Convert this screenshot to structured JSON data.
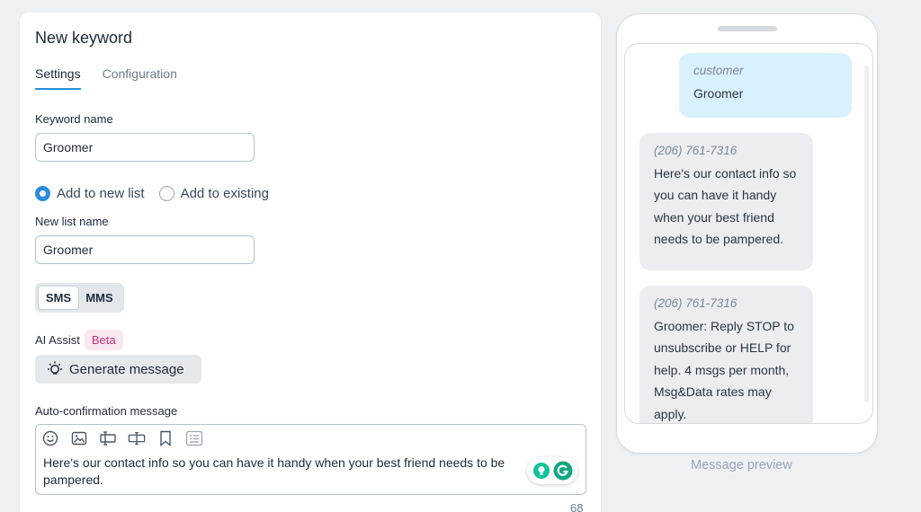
{
  "form": {
    "title": "New keyword",
    "tabs": [
      {
        "label": "Settings",
        "active": true
      },
      {
        "label": "Configuration",
        "active": false
      }
    ],
    "keyword_name": {
      "label": "Keyword name",
      "value": "Groomer"
    },
    "list_mode": {
      "options": [
        {
          "label": "Add to new list",
          "checked": true
        },
        {
          "label": "Add to existing",
          "checked": false
        }
      ]
    },
    "new_list_name": {
      "label": "New list name",
      "value": "Groomer"
    },
    "message_type": {
      "options": [
        {
          "label": "SMS",
          "active": true
        },
        {
          "label": "MMS",
          "active": false
        }
      ]
    },
    "ai_assist": {
      "label": "AI Assist",
      "badge": "Beta",
      "button_label": "Generate message"
    },
    "auto_confirmation": {
      "label": "Auto-confirmation message",
      "toolbar_icons": [
        "emoji-icon",
        "image-icon",
        "variable-icon",
        "link-icon",
        "bookmark-icon",
        "template-icon"
      ],
      "value": "Here's our contact info so you can have it handy when your best friend needs to be pampered.",
      "char_count": "68"
    }
  },
  "preview": {
    "label": "Message preview",
    "messages": [
      {
        "sender": "customer",
        "text": "Groomer",
        "kind": "customer"
      },
      {
        "sender": "(206) 761-7316",
        "text": "Here's our contact info so you can have it handy when your best friend needs to be pampered.",
        "kind": "business"
      },
      {
        "sender": "(206) 761-7316",
        "text": "Groomer: Reply STOP to unsubscribe or HELP for help. 4 msgs per month, Msg&Data rates may apply.",
        "kind": "business"
      }
    ]
  },
  "colors": {
    "accent": "#2a8de0",
    "beta_bg": "#fbe7f1",
    "beta_text": "#c2337a",
    "customer_bubble": "#d9f1fd",
    "business_bubble": "#ebedf0",
    "grammarly_green": "#15c39a"
  }
}
